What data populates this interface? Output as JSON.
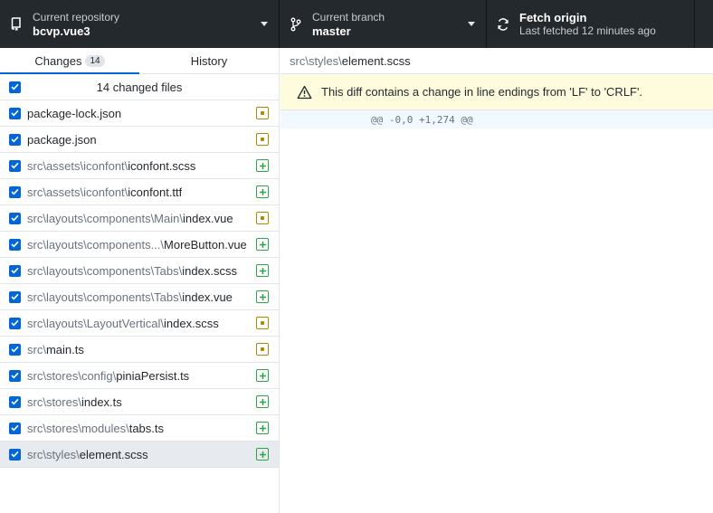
{
  "toolbar": {
    "repository": {
      "label": "Current repository",
      "value": "bcvp.vue3"
    },
    "branch": {
      "label": "Current branch",
      "value": "master"
    },
    "fetch": {
      "title": "Fetch origin",
      "subtitle": "Last fetched 12 minutes ago"
    }
  },
  "sidebar": {
    "tabs": [
      {
        "label": "Changes",
        "count": "14"
      },
      {
        "label": "History"
      }
    ],
    "summary": "14 changed files",
    "files": [
      {
        "dir": "",
        "base": "package-lock.json",
        "status": "modified"
      },
      {
        "dir": "",
        "base": "package.json",
        "status": "modified"
      },
      {
        "dir": "src\\assets\\iconfont\\",
        "base": "iconfont.scss",
        "status": "added"
      },
      {
        "dir": "src\\assets\\iconfont\\",
        "base": "iconfont.ttf",
        "status": "added"
      },
      {
        "dir": "src\\layouts\\components\\Main\\",
        "base": "index.vue",
        "status": "modified"
      },
      {
        "dir": "src\\layouts\\components...\\",
        "base": "MoreButton.vue",
        "status": "added"
      },
      {
        "dir": "src\\layouts\\components\\Tabs\\",
        "base": "index.scss",
        "status": "added"
      },
      {
        "dir": "src\\layouts\\components\\Tabs\\",
        "base": "index.vue",
        "status": "added"
      },
      {
        "dir": "src\\layouts\\LayoutVertical\\",
        "base": "index.scss",
        "status": "modified"
      },
      {
        "dir": "src\\",
        "base": "main.ts",
        "status": "modified"
      },
      {
        "dir": "src\\stores\\config\\",
        "base": "piniaPersist.ts",
        "status": "added"
      },
      {
        "dir": "src\\stores\\",
        "base": "index.ts",
        "status": "added"
      },
      {
        "dir": "src\\stores\\modules\\",
        "base": "tabs.ts",
        "status": "added"
      },
      {
        "dir": "src\\styles\\",
        "base": "element.scss",
        "status": "added"
      }
    ]
  },
  "diff": {
    "path_dir": "src\\styles\\",
    "path_file": "element.scss",
    "warning": "This diff contains a change in line endings from 'LF' to 'CRLF'.",
    "hunk": "@@ -0,0 +1,274 @@"
  },
  "colors": {
    "toolbar_bg": "#24292e",
    "accent": "#0366d6",
    "modified": "#b08800",
    "added": "#28a745",
    "warning_bg": "#fffbdd"
  },
  "icons": {
    "repository": "repo-icon",
    "branch": "git-branch-icon",
    "fetch": "sync-icon",
    "warning": "alert-icon",
    "checkbox": "check-icon"
  }
}
